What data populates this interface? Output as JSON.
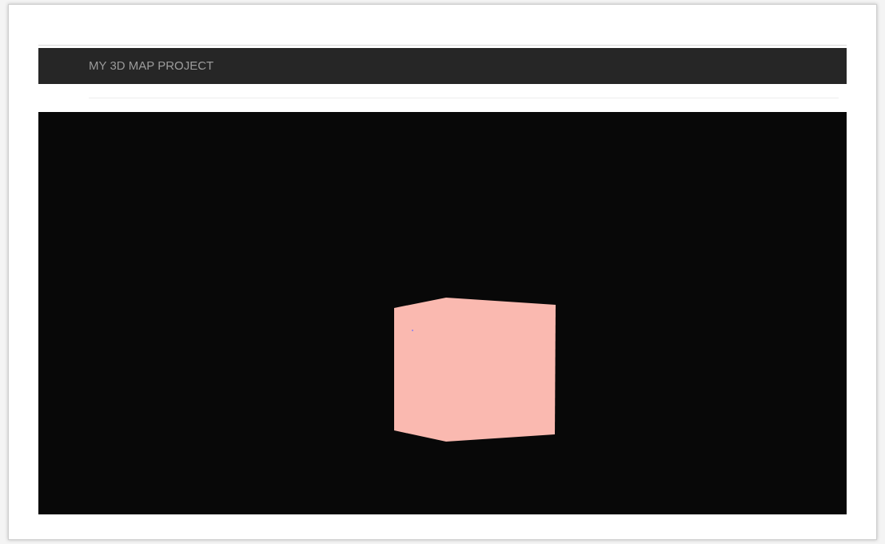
{
  "header": {
    "title": "MY 3D MAP PROJECT"
  },
  "viewport": {
    "kind": "scene"
  }
}
